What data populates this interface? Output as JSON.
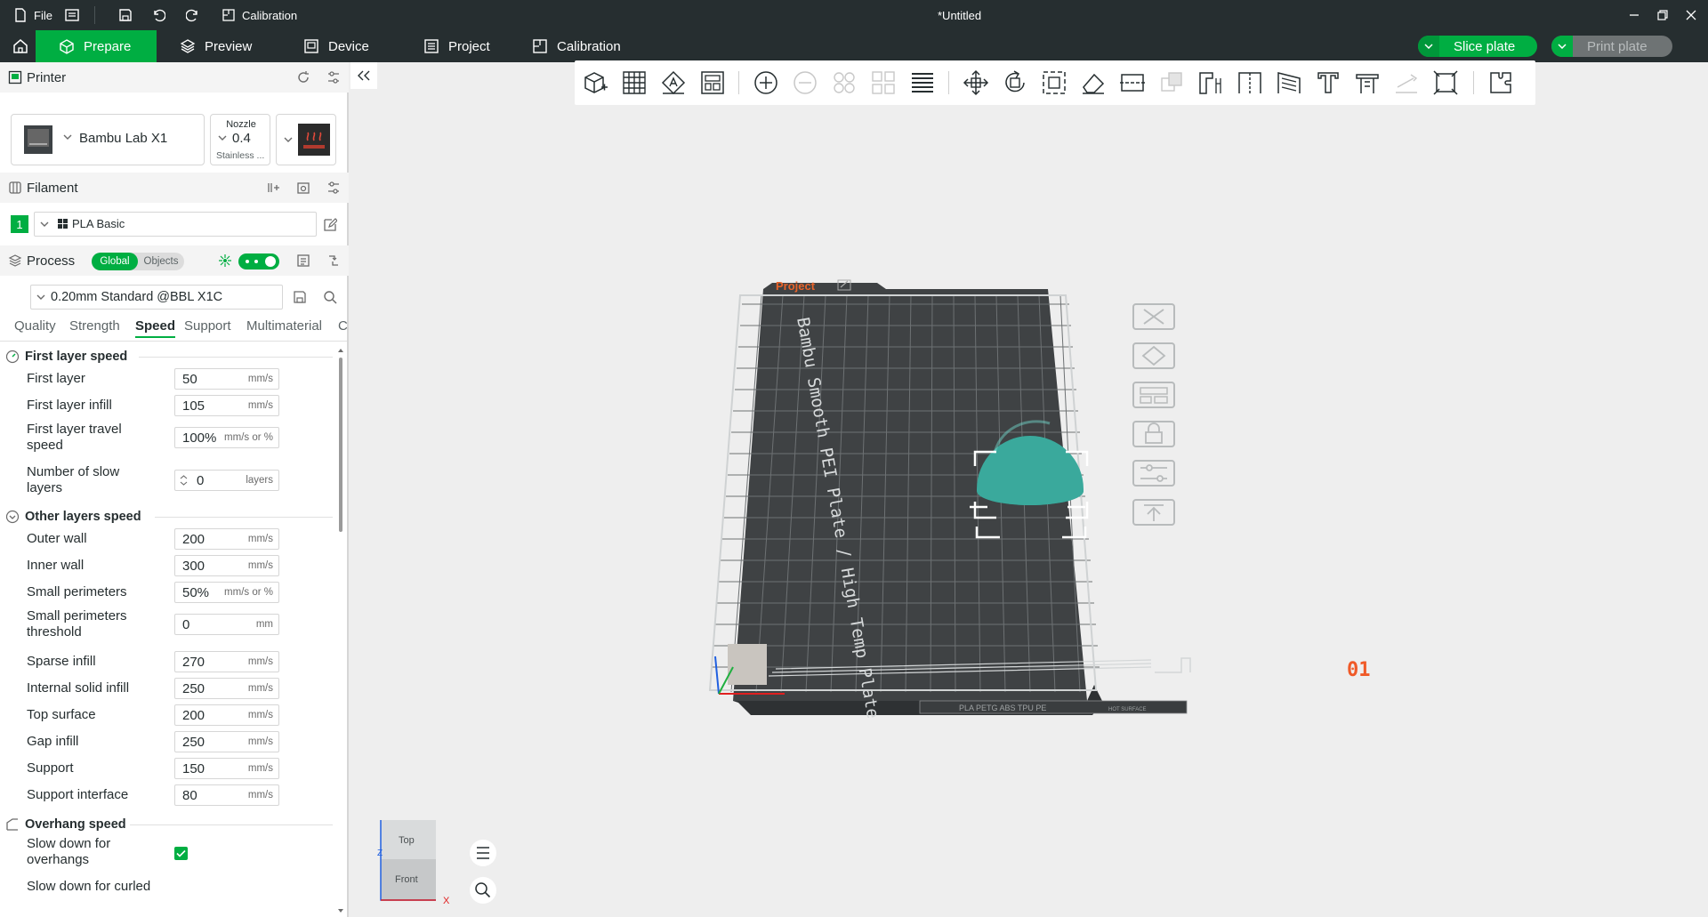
{
  "titlebar": {
    "file_label": "File",
    "calibration_label": "Calibration",
    "document_title": "*Untitled"
  },
  "nav": {
    "tabs": [
      {
        "label": "Prepare",
        "icon": "cube-icon",
        "active": true
      },
      {
        "label": "Preview",
        "icon": "layers-icon",
        "active": false
      },
      {
        "label": "Device",
        "icon": "device-icon",
        "active": false
      },
      {
        "label": "Project",
        "icon": "project-icon",
        "active": false
      },
      {
        "label": "Calibration",
        "icon": "calibration-icon",
        "active": false
      }
    ],
    "slice_label": "Slice plate",
    "print_label": "Print plate"
  },
  "colors": {
    "accent": "#00ae42",
    "dark": "#262e30",
    "bed": "#3f4244",
    "model": "#3aa99c",
    "plate_number": "#f05a28"
  },
  "printer": {
    "section_title": "Printer",
    "name": "Bambu Lab X1",
    "nozzle_label": "Nozzle",
    "nozzle_value": "0.4",
    "nozzle_material": "Stainless ..."
  },
  "filament": {
    "section_title": "Filament",
    "slot": "1",
    "name": "PLA Basic"
  },
  "process": {
    "section_title": "Process",
    "global_label": "Global",
    "objects_label": "Objects",
    "preset": "0.20mm Standard @BBL X1C"
  },
  "tabs": [
    "Quality",
    "Strength",
    "Speed",
    "Support",
    "Multimaterial",
    "C"
  ],
  "settings": {
    "first_layer": {
      "title": "First layer speed",
      "rows": [
        {
          "label": "First layer",
          "value": "50",
          "unit": "mm/s"
        },
        {
          "label": "First layer infill",
          "value": "105",
          "unit": "mm/s"
        },
        {
          "label": "First layer travel speed",
          "value": "100%",
          "unit": "mm/s or %"
        },
        {
          "label": "Number of slow layers",
          "value": "0",
          "unit": "layers"
        }
      ]
    },
    "other_layers": {
      "title": "Other layers speed",
      "rows": [
        {
          "label": "Outer wall",
          "value": "200",
          "unit": "mm/s"
        },
        {
          "label": "Inner wall",
          "value": "300",
          "unit": "mm/s"
        },
        {
          "label": "Small perimeters",
          "value": "50%",
          "unit": "mm/s or %"
        },
        {
          "label": "Small perimeters threshold",
          "value": "0",
          "unit": "mm"
        },
        {
          "label": "Sparse infill",
          "value": "270",
          "unit": "mm/s"
        },
        {
          "label": "Internal solid infill",
          "value": "250",
          "unit": "mm/s"
        },
        {
          "label": "Top surface",
          "value": "200",
          "unit": "mm/s"
        },
        {
          "label": "Gap infill",
          "value": "250",
          "unit": "mm/s"
        },
        {
          "label": "Support",
          "value": "150",
          "unit": "mm/s"
        },
        {
          "label": "Support interface",
          "value": "80",
          "unit": "mm/s"
        }
      ]
    },
    "overhang": {
      "title": "Overhang speed",
      "rows": [
        {
          "label": "Slow down for overhangs",
          "checked": true
        },
        {
          "label": "Slow down for curled"
        }
      ]
    }
  },
  "plate": {
    "project_label": "Project",
    "bed_text": "Bambu Smooth PEI Plate / High Temp Plate",
    "bed_footer": "PLA PETG ABS TPU PE",
    "bed_footer2": "HOT SURFACE",
    "plate_number": "01"
  },
  "viewcube": {
    "top": "Top",
    "front": "Front",
    "axis_z": "Z",
    "axis_x": "X"
  }
}
